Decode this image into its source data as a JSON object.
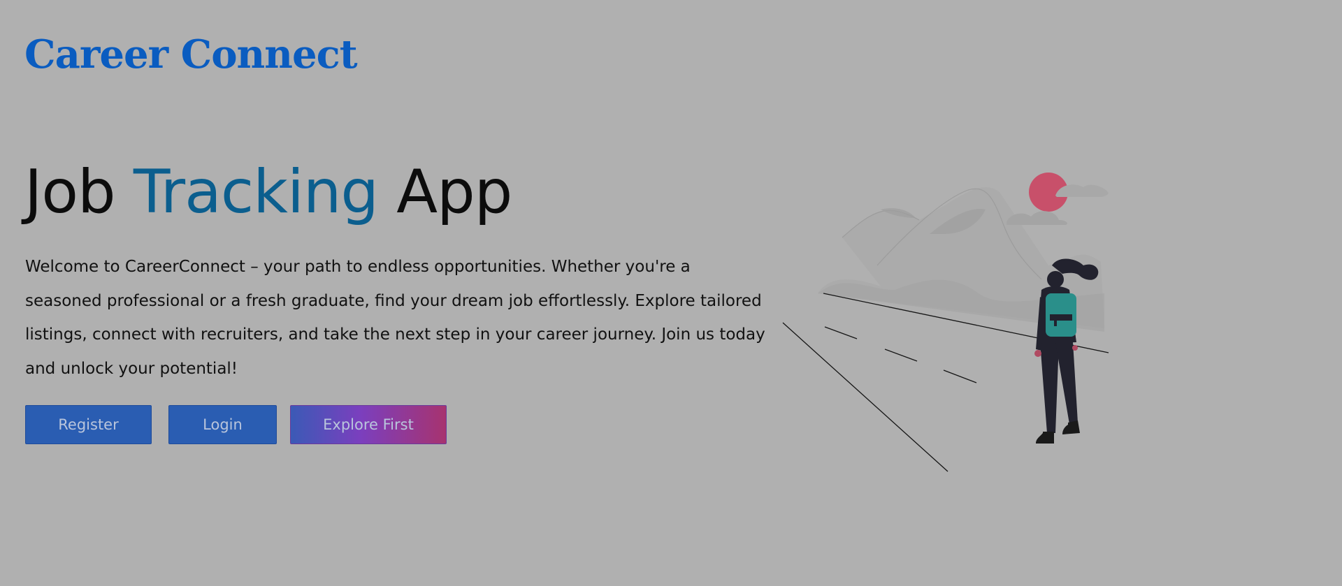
{
  "header": {
    "logo_text": "Career Connect"
  },
  "hero": {
    "title_part1": "Job ",
    "title_accent": "Tracking",
    "title_part2": " App",
    "description": "Welcome to CareerConnect – your path to endless opportunities. Whether you're a seasoned professional or a fresh graduate, find your dream job effortlessly. Explore tailored listings, connect with recruiters, and take the next step in your career journey. Join us today and unlock your potential!"
  },
  "actions": {
    "register_label": "Register",
    "login_label": "Login",
    "explore_label": "Explore First"
  },
  "colors": {
    "background": "#b0b0b0",
    "logo": "#0a5cc0",
    "title_accent": "#0b5e8e",
    "button_primary": "#2a5db2",
    "sun": "#c8506a",
    "backpack": "#2a8f8a"
  }
}
